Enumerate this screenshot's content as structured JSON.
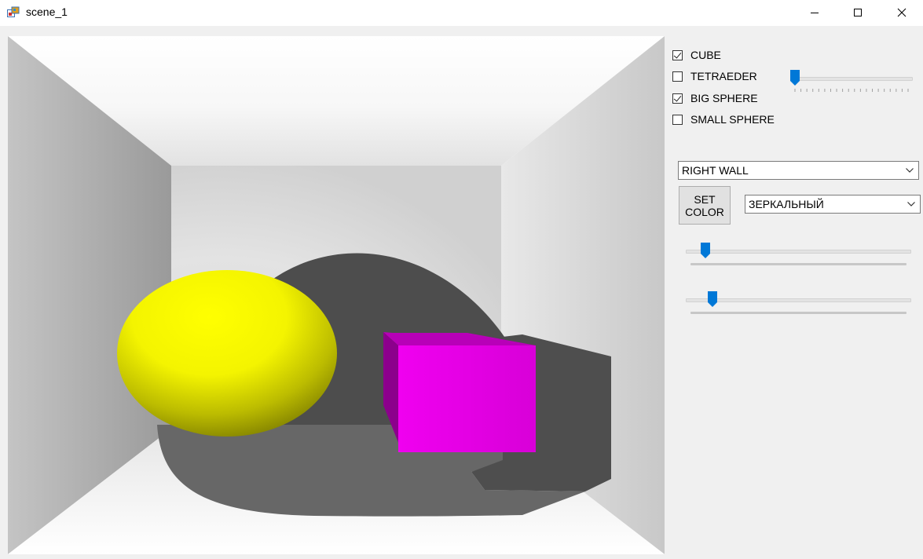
{
  "window": {
    "title": "scene_1",
    "icon": "app-window-icon",
    "controls": [
      "minimize-icon",
      "maximize-icon",
      "close-icon"
    ]
  },
  "objects": [
    {
      "label": "CUBE",
      "checked": true
    },
    {
      "label": "TETRAEDER",
      "checked": false
    },
    {
      "label": "BIG SPHERE",
      "checked": true
    },
    {
      "label": "SMALL SPHERE",
      "checked": false
    }
  ],
  "target_select": {
    "value": "RIGHT WALL"
  },
  "set_color_button": {
    "line1": "SET",
    "line2": "COLOR"
  },
  "material_select": {
    "value": "ЗЕРКАЛЬНЫЙ"
  },
  "sliders": {
    "top": {
      "value_fraction": 0.0
    },
    "first": {
      "value_fraction": 0.07
    },
    "second": {
      "value_fraction": 0.1
    }
  },
  "colors": {
    "accent": "#0078d7",
    "sphere": "#ffff00",
    "cube": "#ee00ee",
    "shadow": "#505050"
  }
}
